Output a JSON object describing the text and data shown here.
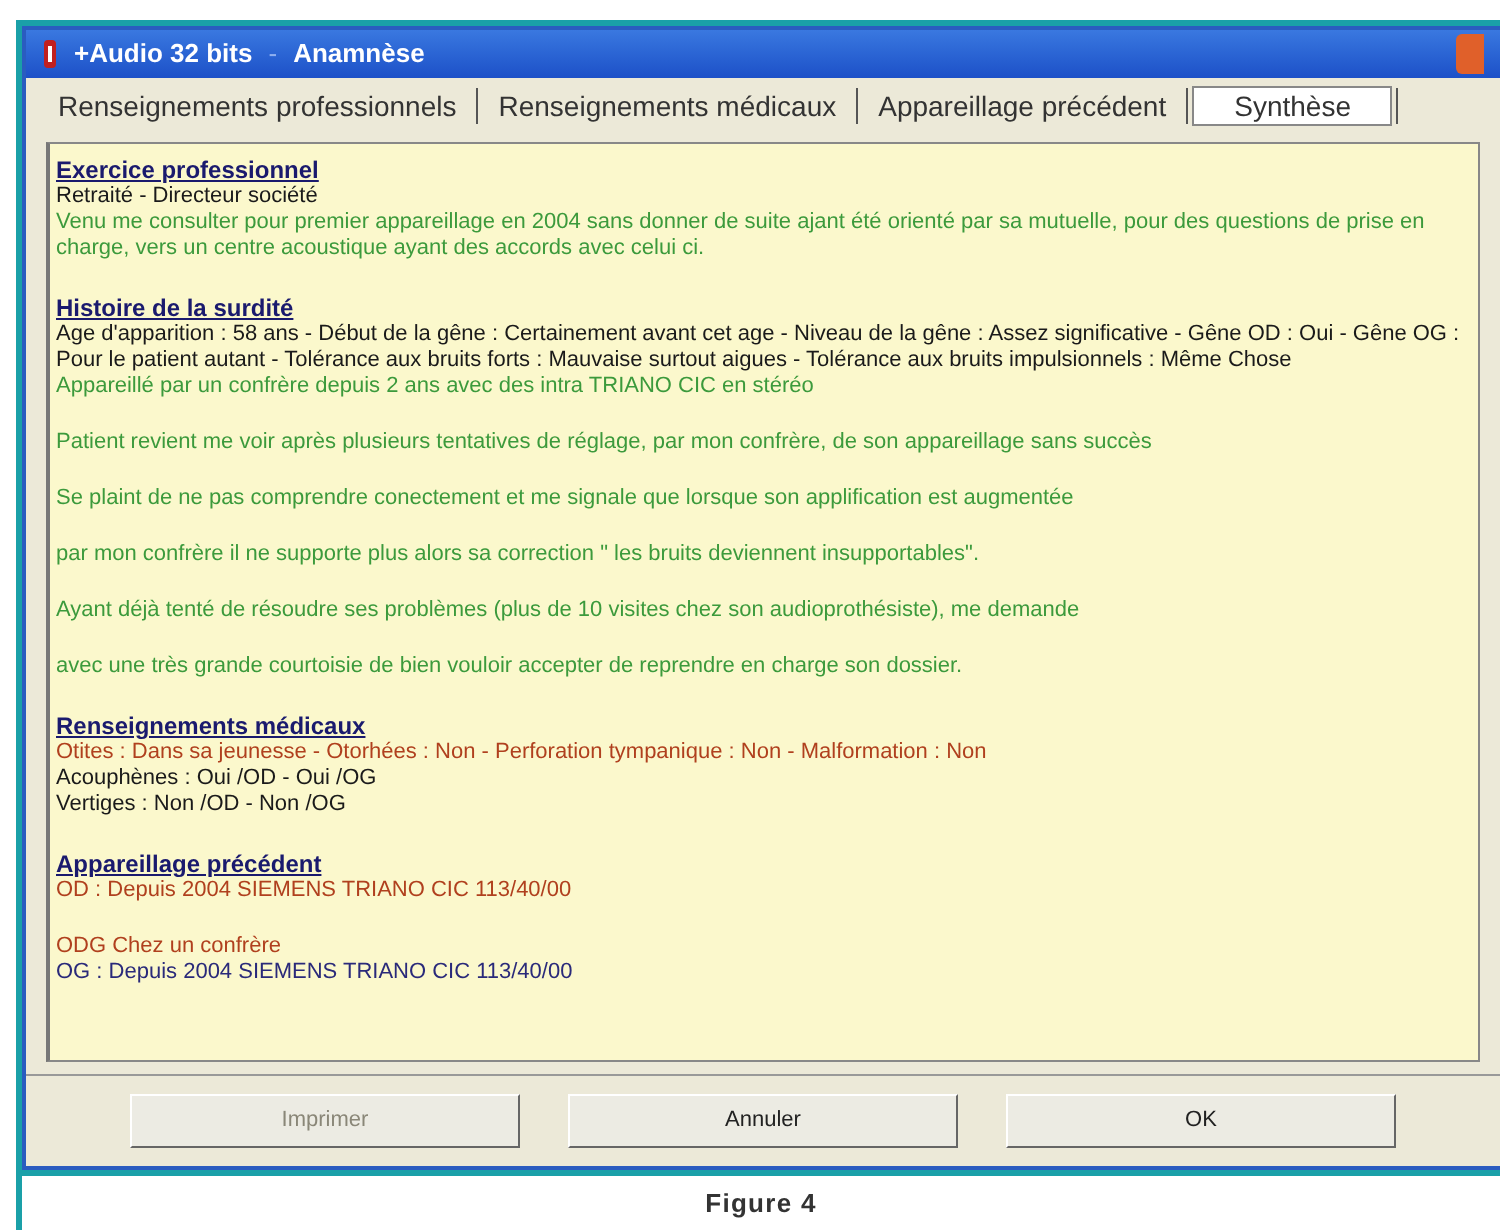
{
  "window": {
    "title": "+Audio 32 bits",
    "separator": "-",
    "subtitle": "Anamnèse"
  },
  "tabs": [
    {
      "label": "Renseignements professionnels",
      "selected": false
    },
    {
      "label": "Renseignements médicaux",
      "selected": false
    },
    {
      "label": "Appareillage précédent",
      "selected": false
    },
    {
      "label": "Synthèse",
      "selected": true
    }
  ],
  "sections": [
    {
      "heading": "Exercice professionnel",
      "blocks": [
        [
          {
            "text": "Retraité - Directeur société",
            "color": "#1a1a1a"
          },
          {
            "text": "Venu me consulter pour premier appareillage en 2004 sans donner de suite ajant été orienté par sa mutuelle, pour des questions de prise en charge, vers un centre acoustique ayant des accords avec celui ci.",
            "color": "#3c9a3c"
          }
        ]
      ]
    },
    {
      "heading": "Histoire de la surdité",
      "blocks": [
        [
          {
            "text": "Age d'apparition : 58 ans - Début de la gêne : Certainement avant cet age - Niveau de la gêne : Assez significative - Gêne OD : Oui - Gêne OG : Pour le patient autant - Tolérance aux bruits forts : Mauvaise surtout aigues - Tolérance aux bruits impulsionnels : Même Chose",
            "color": "#1a1a1a"
          },
          {
            "text": "Appareillé par un confrère depuis 2 ans avec des intra TRIANO CIC en stéréo",
            "color": "#3c9a3c"
          }
        ],
        [
          {
            "text": "Patient revient me voir après plusieurs tentatives de réglage, par mon confrère, de son appareillage sans succès",
            "color": "#3c9a3c"
          }
        ],
        [
          {
            "text": "Se plaint de ne pas comprendre conectement et me signale que lorsque son applification est augmentée",
            "color": "#3c9a3c"
          }
        ],
        [
          {
            "text": "par mon confrère il ne supporte plus alors sa correction \" les bruits deviennent insupportables\".",
            "color": "#3c9a3c"
          }
        ],
        [
          {
            "text": "Ayant déjà tenté de résoudre ses problèmes (plus de 10 visites chez son audioprothésiste), me demande",
            "color": "#3c9a3c"
          }
        ],
        [
          {
            "text": "avec une très grande courtoisie de bien vouloir accepter de reprendre en charge son dossier.",
            "color": "#3c9a3c"
          }
        ]
      ]
    },
    {
      "heading": "Renseignements médicaux",
      "blocks": [
        [
          {
            "text": "Otites : Dans sa jeunesse - Otorhées : Non - Perforation tympanique : Non - Malformation : Non",
            "color": "#b0401e"
          },
          {
            "text": "Acouphènes : Oui /OD - Oui /OG",
            "color": "#1a1a1a"
          },
          {
            "text": "Vertiges : Non /OD - Non /OG",
            "color": "#1a1a1a"
          }
        ]
      ]
    },
    {
      "heading": "Appareillage précédent",
      "blocks": [
        [
          {
            "text": "OD : Depuis 2004 SIEMENS TRIANO CIC 113/40/00",
            "color": "#b0401e"
          }
        ],
        [
          {
            "text": "ODG Chez un confrère",
            "color": "#b0401e"
          },
          {
            "text": "OG : Depuis 2004 SIEMENS TRIANO CIC 113/40/00",
            "color": "#2a2a7a"
          }
        ]
      ]
    }
  ],
  "buttons": [
    {
      "label": "Imprimer",
      "disabled": true
    },
    {
      "label": "Annuler",
      "disabled": false
    },
    {
      "label": "OK",
      "disabled": false
    }
  ],
  "caption": "Figure 4"
}
